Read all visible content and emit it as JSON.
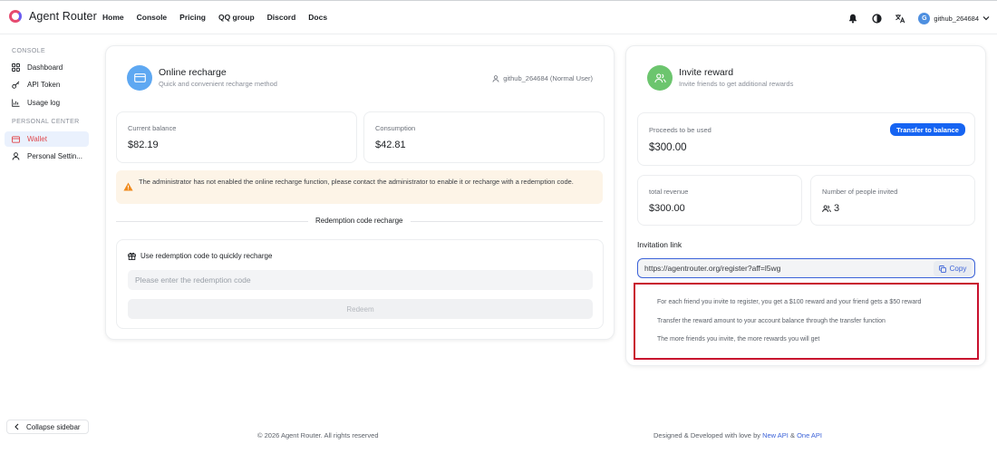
{
  "app": {
    "name": "Agent Router"
  },
  "nav": [
    "Home",
    "Console",
    "Pricing",
    "QQ group",
    "Discord",
    "Docs"
  ],
  "user": {
    "avatar_letter": "G",
    "name": "github_264684"
  },
  "sidebar": {
    "console_section": "CONSOLE",
    "console_items": [
      {
        "label": "Dashboard",
        "icon": "dashboard-icon"
      },
      {
        "label": "API Token",
        "icon": "key-icon"
      },
      {
        "label": "Usage log",
        "icon": "chart-icon"
      }
    ],
    "personal_section": "PERSONAL CENTER",
    "personal_items": [
      {
        "label": "Wallet",
        "icon": "wallet-icon",
        "active": true
      },
      {
        "label": "Personal Settin...",
        "icon": "user-icon"
      }
    ],
    "collapse_label": "Collapse sidebar"
  },
  "recharge": {
    "title": "Online recharge",
    "subtitle": "Quick and convenient recharge method",
    "user_tag": "github_264684 (Normal User)",
    "balance_label": "Current balance",
    "balance_value": "$82.19",
    "consumption_label": "Consumption",
    "consumption_value": "$42.81",
    "warning": "The administrator has not enabled the online recharge function, please contact the administrator to enable it or recharge with a redemption code.",
    "divider_label": "Redemption code recharge",
    "redeem_heading": "Use redemption code to quickly recharge",
    "redeem_placeholder": "Please enter the redemption code",
    "redeem_button": "Redeem"
  },
  "invite": {
    "title": "Invite reward",
    "subtitle": "Invite friends to get additional rewards",
    "proceeds_label": "Proceeds to be used",
    "proceeds_value": "$300.00",
    "transfer_button": "Transfer to balance",
    "revenue_label": "total revenue",
    "revenue_value": "$300.00",
    "invited_label": "Number of people invited",
    "invited_value": "3",
    "link_label": "Invitation link",
    "link_value": "https://agentrouter.org/register?aff=l5wg",
    "copy_button": "Copy",
    "rules": [
      "For each friend you invite to register, you get a $100 reward and your friend gets a $50 reward",
      "Transfer the reward amount to your account balance through the transfer function",
      "The more friends you invite, the more rewards you will get"
    ]
  },
  "footer": {
    "copyright": "© 2026 Agent Router. All rights reserved",
    "credit_prefix": "Designed & Developed with love by",
    "link1": "New API",
    "amp": "&",
    "link2": "One API"
  },
  "colors": {
    "accent": "#1664f2",
    "wallet_active": "#e0484c",
    "recharge_icon_bg": "#5ea8f2",
    "invite_icon_bg": "#6cc56e",
    "highlight_border": "#c8102e"
  }
}
